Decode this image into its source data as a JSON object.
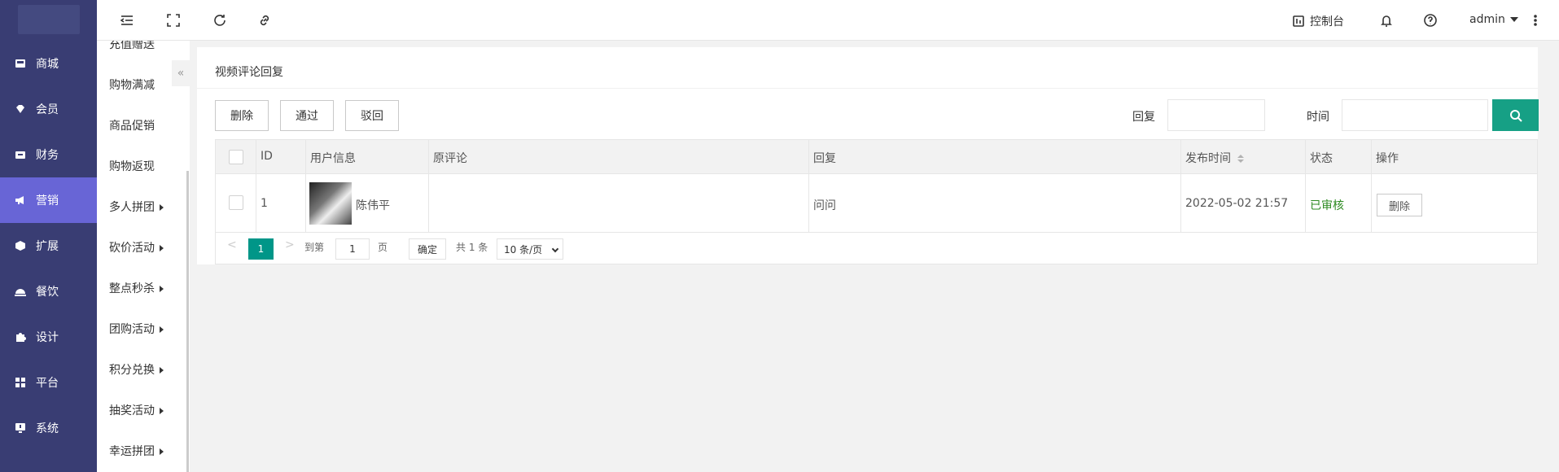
{
  "nav1": {
    "items": [
      {
        "label": "商城",
        "icon": "store-icon"
      },
      {
        "label": "会员",
        "icon": "diamond-icon"
      },
      {
        "label": "财务",
        "icon": "wallet-icon"
      },
      {
        "label": "营销",
        "icon": "megaphone-icon",
        "active": true
      },
      {
        "label": "扩展",
        "icon": "cube-icon"
      },
      {
        "label": "餐饮",
        "icon": "dish-icon"
      },
      {
        "label": "设计",
        "icon": "puzzle-icon"
      },
      {
        "label": "平台",
        "icon": "grid-icon"
      },
      {
        "label": "系统",
        "icon": "monitor-icon"
      }
    ]
  },
  "nav2": {
    "items": [
      {
        "label": "充值赠送"
      },
      {
        "label": "购物满减"
      },
      {
        "label": "商品促销"
      },
      {
        "label": "购物返现"
      },
      {
        "label": "多人拼团",
        "submenu": true
      },
      {
        "label": "砍价活动",
        "submenu": true
      },
      {
        "label": "整点秒杀",
        "submenu": true
      },
      {
        "label": "团购活动",
        "submenu": true
      },
      {
        "label": "积分兑换",
        "submenu": true
      },
      {
        "label": "抽奖活动",
        "submenu": true
      },
      {
        "label": "幸运拼团",
        "submenu": true
      }
    ],
    "collapse": "«"
  },
  "topbar": {
    "console_label": "控制台",
    "user": "admin"
  },
  "page": {
    "title": "视频评论回复",
    "buttons": {
      "delete": "删除",
      "approve": "通过",
      "reject": "驳回"
    },
    "filters": {
      "reply_label": "回复",
      "reply_value": "",
      "time_label": "时间",
      "time_value": ""
    }
  },
  "table": {
    "headers": {
      "id": "ID",
      "user": "用户信息",
      "original": "原评论",
      "reply": "回复",
      "time": "发布时间",
      "status": "状态",
      "action": "操作"
    },
    "rows": [
      {
        "id": "1",
        "user": "陈伟平",
        "original": "",
        "reply": "问问",
        "time": "2022-05-02 21:57",
        "status": "已审核",
        "action": "删除"
      }
    ]
  },
  "pager": {
    "prev": "<",
    "current": "1",
    "next": ">",
    "goto_label": "到第",
    "goto_value": "1",
    "page_unit": "页",
    "confirm": "确定",
    "total": "共 1 条",
    "page_size": "10 条/页"
  },
  "colors": {
    "sidebar": "#393d73",
    "active": "#6865d6",
    "primary": "#009688",
    "search": "#16a085",
    "status_ok": "#2e8b22"
  }
}
